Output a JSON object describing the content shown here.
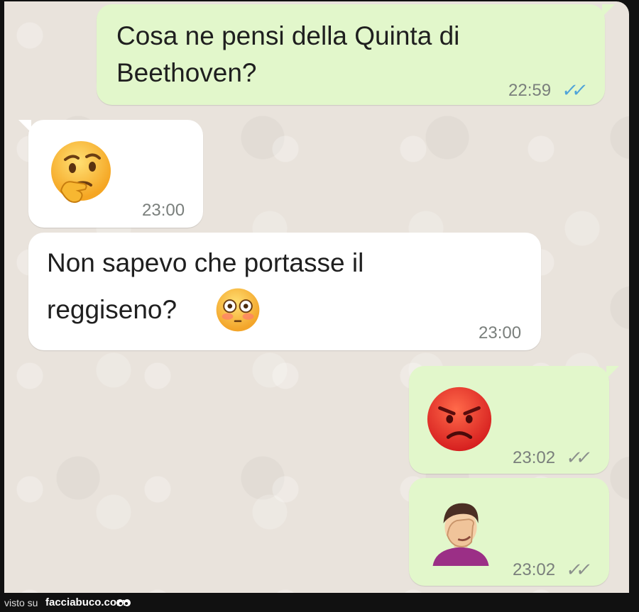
{
  "messages": [
    {
      "direction": "outgoing",
      "text_lines": [
        "Cosa ne pensi della Quinta di",
        "Beethoven?"
      ],
      "time": "22:59",
      "status": "read",
      "ticks": "✓✓"
    },
    {
      "direction": "incoming",
      "emoji": "thinking-face",
      "time": "23:00"
    },
    {
      "direction": "incoming",
      "text_lines": [
        "Non sapevo che portasse il",
        "reggiseno?"
      ],
      "trailing_emoji": "flushed-face",
      "time": "23:00"
    },
    {
      "direction": "outgoing",
      "emoji": "pouting-face",
      "time": "23:02",
      "status": "delivered",
      "ticks": "✓✓"
    },
    {
      "direction": "outgoing",
      "emoji": "person-facepalming",
      "time": "23:02",
      "status": "delivered",
      "ticks": "✓✓"
    }
  ],
  "footer": {
    "visto": "visto su",
    "brand": "facciabuco.com"
  },
  "colors": {
    "outgoing_bubble": "#e2f7cb",
    "incoming_bubble": "#ffffff",
    "chat_background": "#e9e3dc",
    "read_ticks": "#4fa3d9"
  }
}
